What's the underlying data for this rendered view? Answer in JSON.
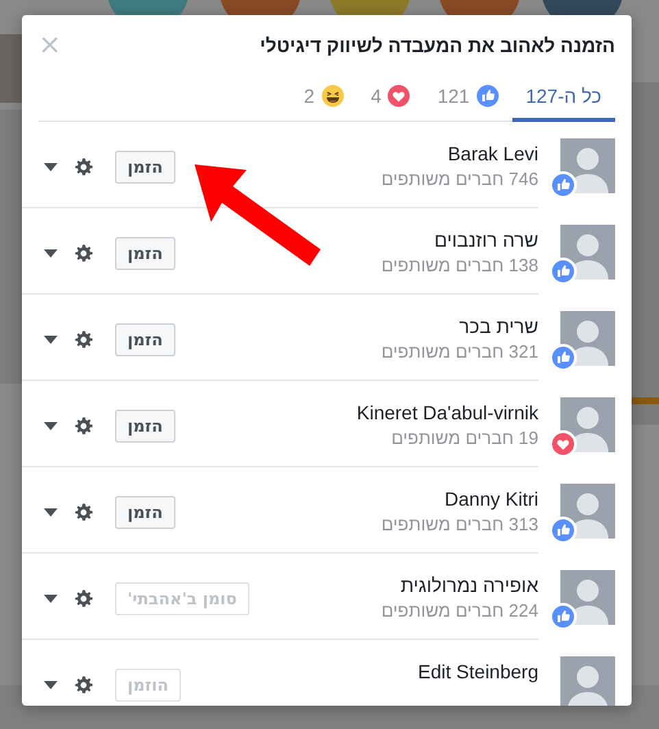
{
  "dialog": {
    "title": "הזמנה לאהוב את המעבדה לשיווק דיגיטלי",
    "close": "×"
  },
  "tabs": [
    {
      "kind": "all",
      "label": "כל ה-127",
      "selected": true
    },
    {
      "kind": "like",
      "label": "121",
      "selected": false
    },
    {
      "kind": "love",
      "label": "4",
      "selected": false
    },
    {
      "kind": "haha",
      "label": "2",
      "selected": false
    }
  ],
  "people": [
    {
      "name": "Barak Levi",
      "mutual": "746 חברים משותפים",
      "kind": "like",
      "button": "הזמן",
      "disabled": false
    },
    {
      "name": "שרה רוזנבוים",
      "mutual": "138 חברים משותפים",
      "kind": "like",
      "button": "הזמן",
      "disabled": false
    },
    {
      "name": "שרית בכר",
      "mutual": "321 חברים משותפים",
      "kind": "like",
      "button": "הזמן",
      "disabled": false
    },
    {
      "name": "Kineret Da'abul-virnik",
      "mutual": "19 חברים משותפים",
      "kind": "love",
      "button": "הזמן",
      "disabled": false
    },
    {
      "name": "Danny Kitri",
      "mutual": "313 חברים משותפים",
      "kind": "like",
      "button": "הזמן",
      "disabled": false
    },
    {
      "name": "אופירה נמרולוגית",
      "mutual": "224 חברים משותפים",
      "kind": "like",
      "button": "סומן ב'אהבתי'",
      "disabled": true
    },
    {
      "name": "Edit Steinberg",
      "button": "הוזמן",
      "disabled": true
    }
  ]
}
